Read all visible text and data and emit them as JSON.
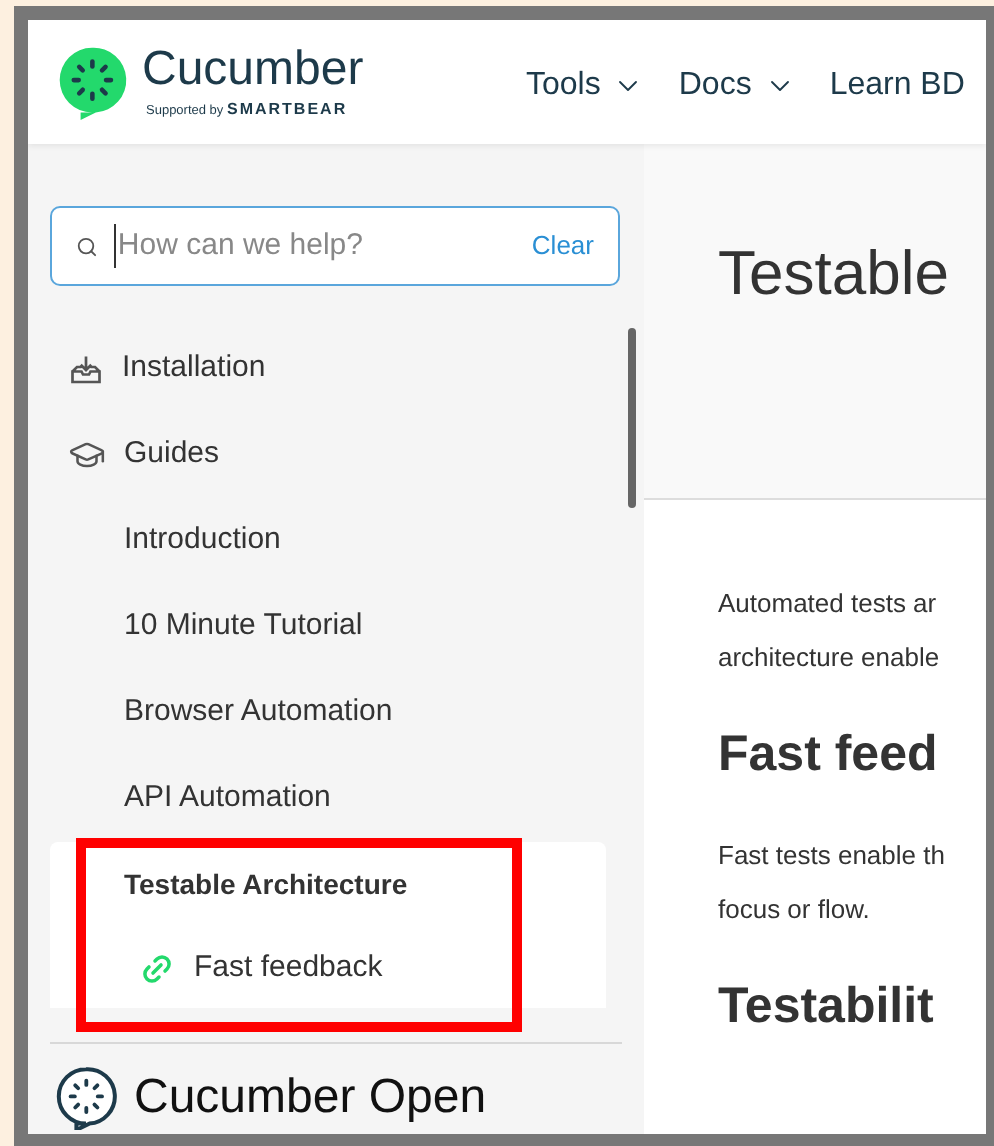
{
  "header": {
    "logo": {
      "name": "Cucumber",
      "tagline_prefix": "Supported by",
      "tagline_brand": "SMARTBEAR"
    },
    "nav": [
      {
        "label": "Tools",
        "dropdown": true
      },
      {
        "label": "Docs",
        "dropdown": true
      },
      {
        "label": "Learn BD",
        "dropdown": false
      }
    ]
  },
  "sidebar": {
    "search": {
      "placeholder": "How can we help?",
      "clear": "Clear"
    },
    "items": [
      {
        "kind": "section",
        "label": "Installation"
      },
      {
        "kind": "section",
        "label": "Guides",
        "children": [
          {
            "label": "Introduction",
            "selected": false
          },
          {
            "label": "10 Minute Tutorial",
            "selected": false
          },
          {
            "label": "Browser Automation",
            "selected": false
          },
          {
            "label": "API Automation",
            "selected": false
          },
          {
            "label": "Testable Architecture",
            "selected": true,
            "children": [
              {
                "label": "Fast feedback"
              }
            ]
          }
        ]
      }
    ],
    "footer": {
      "label": "Cucumber Open"
    }
  },
  "main": {
    "title": "Testable",
    "content": [
      {
        "kind": "paragraph",
        "lines": [
          "Automated tests ar",
          "architecture enable"
        ]
      },
      {
        "kind": "heading",
        "text": "Fast feed"
      },
      {
        "kind": "paragraph",
        "lines": [
          "Fast tests enable th",
          "focus or flow."
        ]
      },
      {
        "kind": "heading",
        "text": "Testabilit"
      }
    ]
  }
}
